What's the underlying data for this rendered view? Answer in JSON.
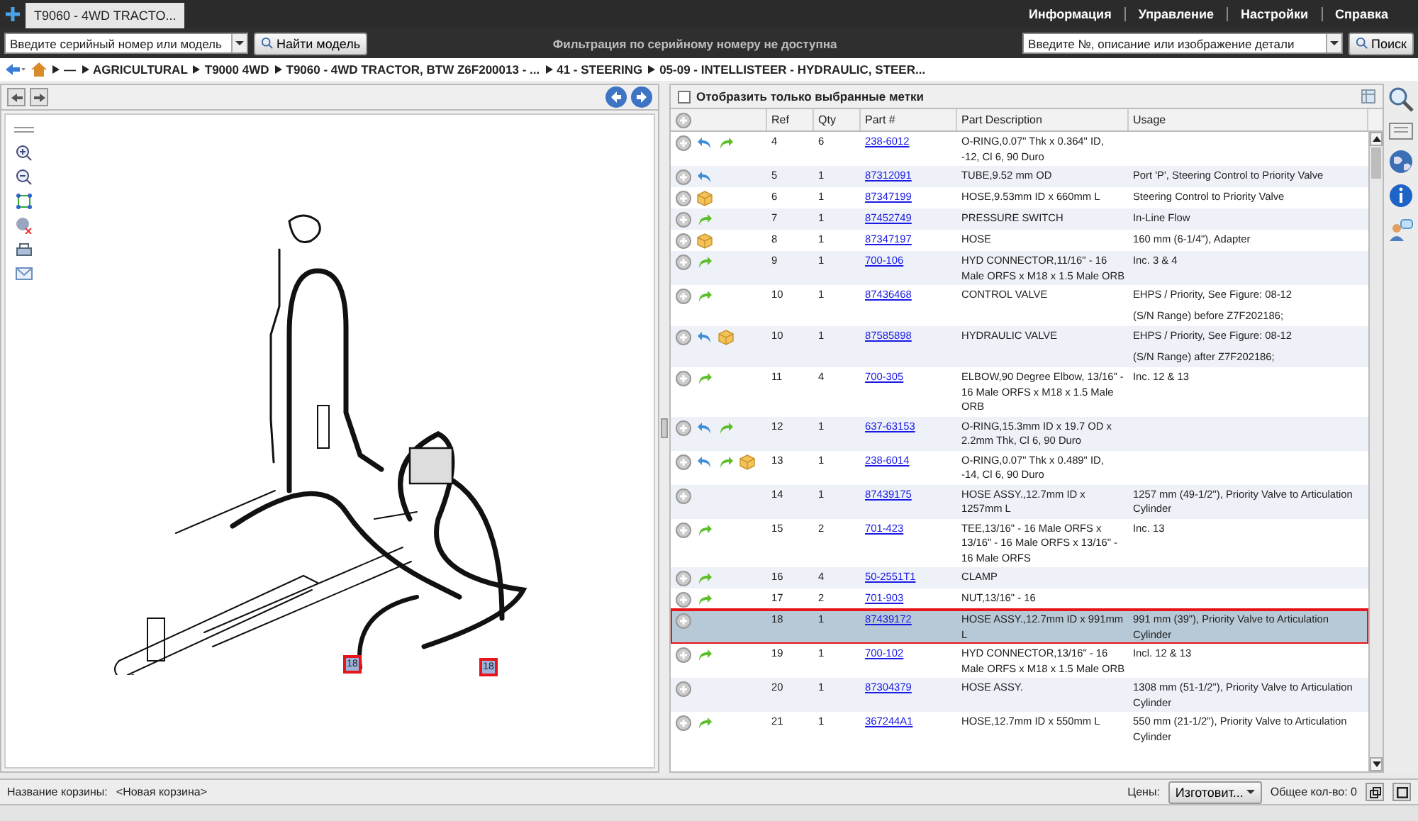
{
  "tab_bar": {
    "tabs": [
      {
        "title": "T9060 - 4WD TRACTO...",
        "selected": true
      }
    ],
    "menu": [
      "Информация",
      "Управление",
      "Настройки",
      "Справка"
    ]
  },
  "toolbar": {
    "model_field": {
      "placeholder": "Введите серийный номер или модель"
    },
    "find_model_button": "Найти модель",
    "filter_notice": "Фильтрация по серийному номеру не доступна",
    "part_field": {
      "placeholder": "Введите №, описание или изображение детали"
    },
    "search_button": "Поиск"
  },
  "breadcrumbs": [
    "—",
    "AGRICULTURAL",
    "T9000 4WD",
    "T9060 - 4WD TRACTOR, BTW Z6F200013 - ...",
    "41 - STEERING",
    "05-09 - INTELLISTEER - HYDRAULIC, STEER..."
  ],
  "diagram": {
    "hotspots": [
      {
        "label": "18",
        "selected": true,
        "annotated": true
      },
      {
        "label": "18",
        "selected": true,
        "annotated": true
      }
    ]
  },
  "parts_panel": {
    "filter": {
      "label": "Отобразить только выбранные метки",
      "checked": false
    },
    "columns": [
      "Ref",
      "Qty",
      "Part #",
      "Part Description",
      "Usage"
    ],
    "rows": [
      {
        "kind": "part",
        "back": true,
        "forward": true,
        "box": false,
        "ref": "4",
        "qty": "6",
        "part": "238-6012",
        "description": "O-RING,0.07\" Thk x 0.364\" ID, -12, Cl 6, 90 Duro",
        "usage": "",
        "selected": false,
        "annotated": false
      },
      {
        "kind": "part",
        "back": true,
        "forward": false,
        "box": false,
        "ref": "5",
        "qty": "1",
        "part": "87312091",
        "description": "TUBE,9.52 mm OD",
        "usage": "Port 'P', Steering Control to Priority Valve",
        "selected": false,
        "annotated": false
      },
      {
        "kind": "part",
        "back": false,
        "forward": false,
        "box": true,
        "ref": "6",
        "qty": "1",
        "part": "87347199",
        "description": "HOSE,9.53mm ID x 660mm L",
        "usage": "Steering Control to Priority Valve",
        "selected": false,
        "annotated": false
      },
      {
        "kind": "part",
        "back": false,
        "forward": true,
        "box": false,
        "ref": "7",
        "qty": "1",
        "part": "87452749",
        "description": "PRESSURE SWITCH",
        "usage": "In-Line Flow",
        "selected": false,
        "annotated": false
      },
      {
        "kind": "part",
        "back": false,
        "forward": false,
        "box": true,
        "ref": "8",
        "qty": "1",
        "part": "87347197",
        "description": "HOSE",
        "usage": "160 mm (6-1/4\"), Adapter",
        "selected": false,
        "annotated": false
      },
      {
        "kind": "part",
        "back": false,
        "forward": true,
        "box": false,
        "ref": "9",
        "qty": "1",
        "part": "700-106",
        "description": "HYD CONNECTOR,11/16\" - 16 Male ORFS x M18 x 1.5 Male ORB",
        "usage": "Inc. 3 & 4",
        "selected": false,
        "annotated": false
      },
      {
        "kind": "part",
        "back": false,
        "forward": true,
        "box": false,
        "ref": "10",
        "qty": "1",
        "part": "87436468",
        "description": "CONTROL VALVE",
        "usage": "EHPS / Priority, See Figure: 08-12",
        "selected": false,
        "annotated": false
      },
      {
        "kind": "note",
        "usage": "(S/N Range) before Z7F202186;"
      },
      {
        "kind": "part",
        "back": true,
        "forward": false,
        "box": true,
        "ref": "10",
        "qty": "1",
        "part": "87585898",
        "description": "HYDRAULIC VALVE",
        "usage": "EHPS / Priority, See Figure: 08-12",
        "selected": false,
        "annotated": false
      },
      {
        "kind": "note",
        "usage": "(S/N Range) after Z7F202186;"
      },
      {
        "kind": "part",
        "back": false,
        "forward": true,
        "box": false,
        "ref": "11",
        "qty": "4",
        "part": "700-305",
        "description": "ELBOW,90 Degree Elbow, 13/16\" - 16 Male ORFS x M18 x 1.5 Male ORB",
        "usage": "Inc. 12 & 13",
        "selected": false,
        "annotated": false
      },
      {
        "kind": "part",
        "back": true,
        "forward": true,
        "box": false,
        "ref": "12",
        "qty": "1",
        "part": "637-63153",
        "description": "O-RING,15.3mm ID x 19.7 OD x 2.2mm Thk, Cl 6, 90 Duro",
        "usage": "",
        "selected": false,
        "annotated": false
      },
      {
        "kind": "part",
        "back": true,
        "forward": true,
        "box": true,
        "ref": "13",
        "qty": "1",
        "part": "238-6014",
        "description": "O-RING,0.07\" Thk x 0.489\" ID, -14, Cl 6, 90 Duro",
        "usage": "",
        "selected": false,
        "annotated": false
      },
      {
        "kind": "part",
        "back": false,
        "forward": false,
        "box": false,
        "ref": "14",
        "qty": "1",
        "part": "87439175",
        "description": "HOSE ASSY.,12.7mm ID x 1257mm L",
        "usage": "1257 mm (49-1/2\"), Priority Valve to Articulation Cylinder",
        "selected": false,
        "annotated": false
      },
      {
        "kind": "part",
        "back": false,
        "forward": true,
        "box": false,
        "ref": "15",
        "qty": "2",
        "part": "701-423",
        "description": "TEE,13/16\" - 16 Male ORFS x 13/16\" - 16 Male ORFS x 13/16\" - 16 Male ORFS",
        "usage": "Inc. 13",
        "selected": false,
        "annotated": false
      },
      {
        "kind": "part",
        "back": false,
        "forward": true,
        "box": false,
        "ref": "16",
        "qty": "4",
        "part": "50-2551T1",
        "description": "CLAMP",
        "usage": "",
        "selected": false,
        "annotated": false
      },
      {
        "kind": "part",
        "back": false,
        "forward": true,
        "box": false,
        "ref": "17",
        "qty": "2",
        "part": "701-903",
        "description": "NUT,13/16\" - 16",
        "usage": "",
        "selected": false,
        "annotated": false
      },
      {
        "kind": "part",
        "back": false,
        "forward": false,
        "box": false,
        "ref": "18",
        "qty": "1",
        "part": "87439172",
        "description": "HOSE ASSY.,12.7mm ID x 991mm L",
        "usage": "991 mm (39\"), Priority Valve to Articulation Cylinder",
        "selected": true,
        "annotated": true
      },
      {
        "kind": "part",
        "back": false,
        "forward": true,
        "box": false,
        "ref": "19",
        "qty": "1",
        "part": "700-102",
        "description": "HYD CONNECTOR,13/16\" - 16 Male ORFS x M18 x 1.5 Male ORB",
        "usage": "Incl. 12 & 13",
        "selected": false,
        "annotated": false
      },
      {
        "kind": "part",
        "back": false,
        "forward": false,
        "box": false,
        "ref": "20",
        "qty": "1",
        "part": "87304379",
        "description": "HOSE ASSY.",
        "usage": "1308 mm (51-1/2\"), Priority Valve to Articulation Cylinder",
        "selected": false,
        "annotated": false
      },
      {
        "kind": "part",
        "back": false,
        "forward": true,
        "box": false,
        "ref": "21",
        "qty": "1",
        "part": "367244A1",
        "description": "HOSE,12.7mm ID x 550mm L",
        "usage": "550 mm (21-1/2\"), Priority Valve to Articulation Cylinder",
        "selected": false,
        "annotated": false
      }
    ]
  },
  "status_bar": {
    "cart_label": "Название корзины:",
    "cart_name": "<Новая корзина>",
    "prices_label": "Цены:",
    "prices_select": "Изготовит...",
    "total": "Общее кол-во: 0"
  }
}
